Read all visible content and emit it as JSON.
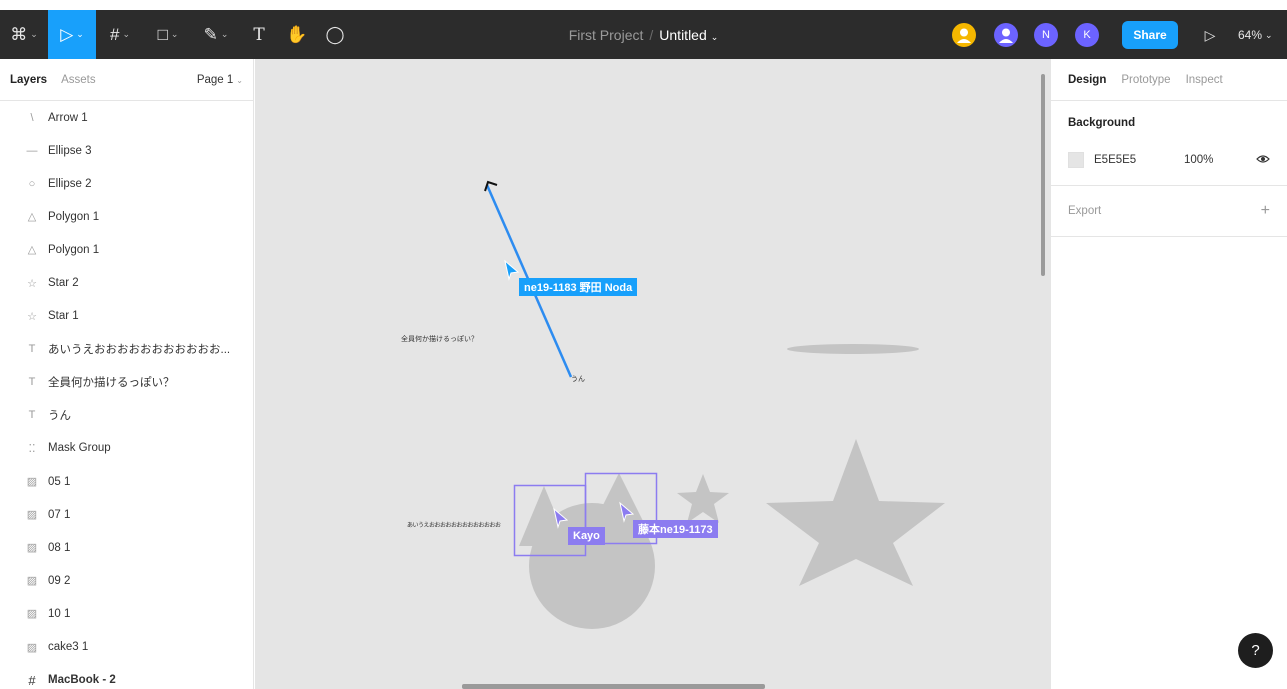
{
  "toolbar": {
    "tools": [
      {
        "name": "main-menu",
        "icon": "⌘",
        "caret": true
      },
      {
        "name": "move-tool",
        "icon": "▷",
        "caret": true,
        "active": true
      },
      {
        "name": "frame-tool",
        "icon": "#",
        "caret": true
      },
      {
        "name": "shape-tool",
        "icon": "□",
        "caret": true
      },
      {
        "name": "pen-tool",
        "icon": "✎",
        "caret": true
      },
      {
        "name": "text-tool",
        "icon": "T",
        "caret": false
      },
      {
        "name": "hand-tool",
        "icon": "✋",
        "caret": false
      },
      {
        "name": "comment-tool",
        "icon": "◯",
        "caret": false
      }
    ],
    "project": "First Project",
    "separator": "/",
    "file_name": "Untitled",
    "avatars": [
      {
        "label": "",
        "color": "#f5b700"
      },
      {
        "label": "",
        "color": "#6c63ff"
      },
      {
        "label": "N",
        "color": "#6c63ff"
      },
      {
        "label": "K",
        "color": "#6c63ff"
      }
    ],
    "share_label": "Share",
    "zoom_label": "64%"
  },
  "left_panel": {
    "tabs": [
      "Layers",
      "Assets"
    ],
    "page_label": "Page 1",
    "layers": [
      {
        "icon": "\\",
        "name": "Arrow 1"
      },
      {
        "icon": "—",
        "name": "Ellipse 3"
      },
      {
        "icon": "○",
        "name": "Ellipse 2"
      },
      {
        "icon": "△",
        "name": "Polygon 1"
      },
      {
        "icon": "△",
        "name": "Polygon 1"
      },
      {
        "icon": "☆",
        "name": "Star 2"
      },
      {
        "icon": "☆",
        "name": "Star 1"
      },
      {
        "icon": "T",
        "name": "あいうえおおおおおおおおおおお..."
      },
      {
        "icon": "T",
        "name": "全員何か描けるっぽい？"
      },
      {
        "icon": "T",
        "name": "うん"
      },
      {
        "icon": "⁚⁚",
        "name": "Mask Group"
      },
      {
        "icon": "▨",
        "name": "05 1"
      },
      {
        "icon": "▨",
        "name": "07 1"
      },
      {
        "icon": "▨",
        "name": "08 1"
      },
      {
        "icon": "▨",
        "name": "09 2"
      },
      {
        "icon": "▨",
        "name": "10 1"
      },
      {
        "icon": "▨",
        "name": "cake3 1"
      },
      {
        "icon": "#",
        "name": "MacBook - 2",
        "frame": true
      }
    ]
  },
  "canvas": {
    "background": "#e5e5e5",
    "cursors": [
      {
        "label": "ne19-1183 野田 Noda",
        "color": "#18a0fb"
      },
      {
        "label": "Kayo",
        "color": "#8c7cf0"
      },
      {
        "label": "藤本ne19-1173",
        "color": "#8c7cf0"
      }
    ],
    "texts": {
      "question": "全員何か描けるっぽい？",
      "un": "うん",
      "aiueo": "あいうえおおおおおおおおおおおおお"
    }
  },
  "right_panel": {
    "tabs": [
      "Design",
      "Prototype",
      "Inspect"
    ],
    "background_title": "Background",
    "bg_hex": "E5E5E5",
    "bg_opacity": "100%",
    "export_label": "Export",
    "help_label": "?"
  },
  "colors": {
    "accent": "#18a0fb",
    "multiplayer": "#8c7cf0",
    "toolbar": "#2c2c2c",
    "shape_fill": "#c4c4c4"
  }
}
